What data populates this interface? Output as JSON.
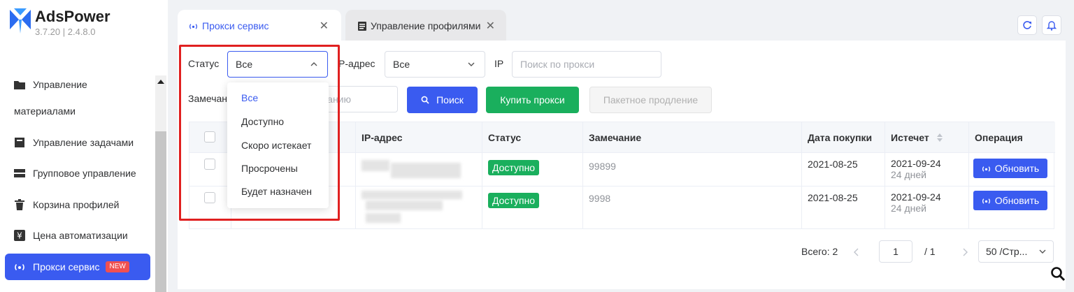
{
  "app": {
    "brand": "AdsPower",
    "version": "3.7.20  |  2.4.8.0"
  },
  "sidebar": {
    "items": [
      {
        "label_line1": "Управление",
        "label_line2": "материалами",
        "icon": "folder-icon"
      },
      {
        "label": "Управление задачами",
        "icon": "task-icon"
      },
      {
        "label": "Групповое управление",
        "icon": "group-icon"
      },
      {
        "label": "Корзина профилей",
        "icon": "trash-icon"
      },
      {
        "label": "Цена автоматизации",
        "icon": "yen-icon"
      }
    ],
    "active": {
      "label": "Прокси сервис",
      "badge": "NEW",
      "icon": "proxy-icon"
    }
  },
  "tabs": [
    {
      "label": "Прокси сервис",
      "close": "✕"
    },
    {
      "label": "Управление профилями",
      "close": "✕"
    }
  ],
  "filters": {
    "status_label": "Статус",
    "status_value": "Все",
    "ip_label": "P-адрес",
    "ip_value": "Все",
    "ip_search_label": "IP",
    "ip_search_placeholder": "Поиск по прокси",
    "remark_label": "Замечан",
    "remark_placeholder": "анию"
  },
  "buttons": {
    "search": "Поиск",
    "buy": "Купить прокси",
    "batch_renew": "Пакетное продление"
  },
  "dropdown": {
    "options": [
      "Все",
      "Доступно",
      "Скоро истекает",
      "Просрочены",
      "Будет назначен"
    ],
    "selected": "Все"
  },
  "table": {
    "headers": {
      "ip": "IP-адрес",
      "status": "Статус",
      "remark": "Замечание",
      "purchase_date": "Дата покупки",
      "expires": "Истечет",
      "operation": "Операция"
    },
    "rows": [
      {
        "status": "Доступно",
        "remark": "99899",
        "purchase_date": "2021-08-25",
        "expires": "2021-09-24",
        "remaining": "24 дней",
        "action": "Обновить"
      },
      {
        "status": "Доступно",
        "remark": "9998",
        "purchase_date": "2021-08-25",
        "expires": "2021-09-24",
        "remaining": "24 дней",
        "action": "Обновить"
      }
    ]
  },
  "pagination": {
    "total_label": "Всего: 2",
    "current": "1",
    "of": "/ 1",
    "page_size": "50 /Стр..."
  },
  "colors": {
    "accent": "#3a5bf0",
    "success": "#1aaf5d",
    "highlight": "#e02020",
    "badge": "#f05050"
  }
}
